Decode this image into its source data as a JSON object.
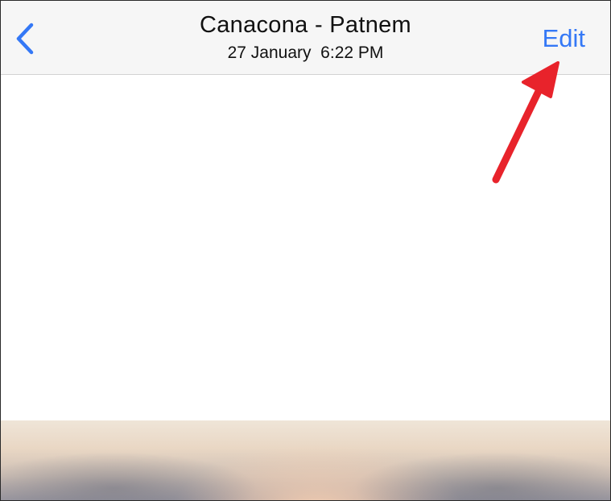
{
  "header": {
    "back_icon": "chevron-left-icon",
    "title": "Canacona - Patnem",
    "subtitle": "27 January  6:22 PM",
    "edit_label": "Edit"
  },
  "annotation": {
    "icon": "red-arrow-icon",
    "color": "#e8232b"
  },
  "colors": {
    "accent": "#3478f6",
    "nav_background": "#f6f6f6"
  }
}
